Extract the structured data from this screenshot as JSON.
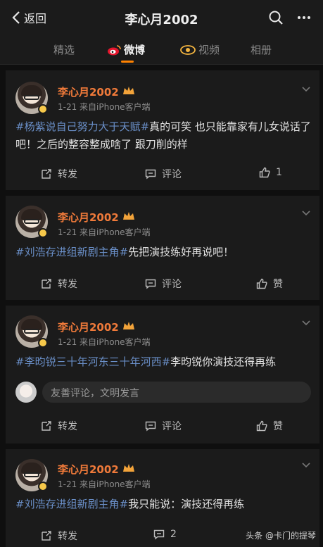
{
  "header": {
    "back_label": "返回",
    "title": "李心月2002"
  },
  "tabs": [
    {
      "label": "精选"
    },
    {
      "label": "微博"
    },
    {
      "label": "视频"
    },
    {
      "label": "相册"
    }
  ],
  "posts": [
    {
      "username": "李心月2002",
      "meta": "1-21  来自iPhone客户端",
      "tag": "#杨紫说自己努力大于天赋#",
      "text": "真的可笑 也只能靠家有儿女说话了吧！之后的整容整成啥了 跟刀削的样",
      "repost": "转发",
      "comment": "评论",
      "like": "1"
    },
    {
      "username": "李心月2002",
      "meta": "1-21  来自iPhone客户端",
      "tag": "#刘浩存进组新剧主角#",
      "text": "先把演技练好再说吧！",
      "repost": "转发",
      "comment": "评论",
      "like": "赞"
    },
    {
      "username": "李心月2002",
      "meta": "1-21  来自iPhone客户端",
      "tag": "#李昀锐三十年河东三十年河西#",
      "text": "李昀锐你演技还得再练",
      "comment_placeholder": "友善评论，文明发言",
      "repost": "转发",
      "comment": "评论",
      "like": "赞"
    },
    {
      "username": "李心月2002",
      "meta": "1-21  来自iPhone客户端",
      "tag": "#刘浩存进组新剧主角#",
      "text": "我只能说：演技还得再练",
      "repost": "转发",
      "comment": "2"
    }
  ],
  "watermark": "头条 @卡门的提琴",
  "colors": {
    "accent": "#ff8200",
    "username": "#f07a3a",
    "hashtag": "#6a8fc8",
    "background": "#0f0f0f",
    "card": "#1b1b1b"
  },
  "icons": [
    "back-icon",
    "search-icon",
    "more-icon",
    "weibo-icon",
    "video-icon",
    "repost-icon",
    "comment-icon",
    "like-icon",
    "chevron-down-icon",
    "crown-icon",
    "verified-badge-icon"
  ]
}
